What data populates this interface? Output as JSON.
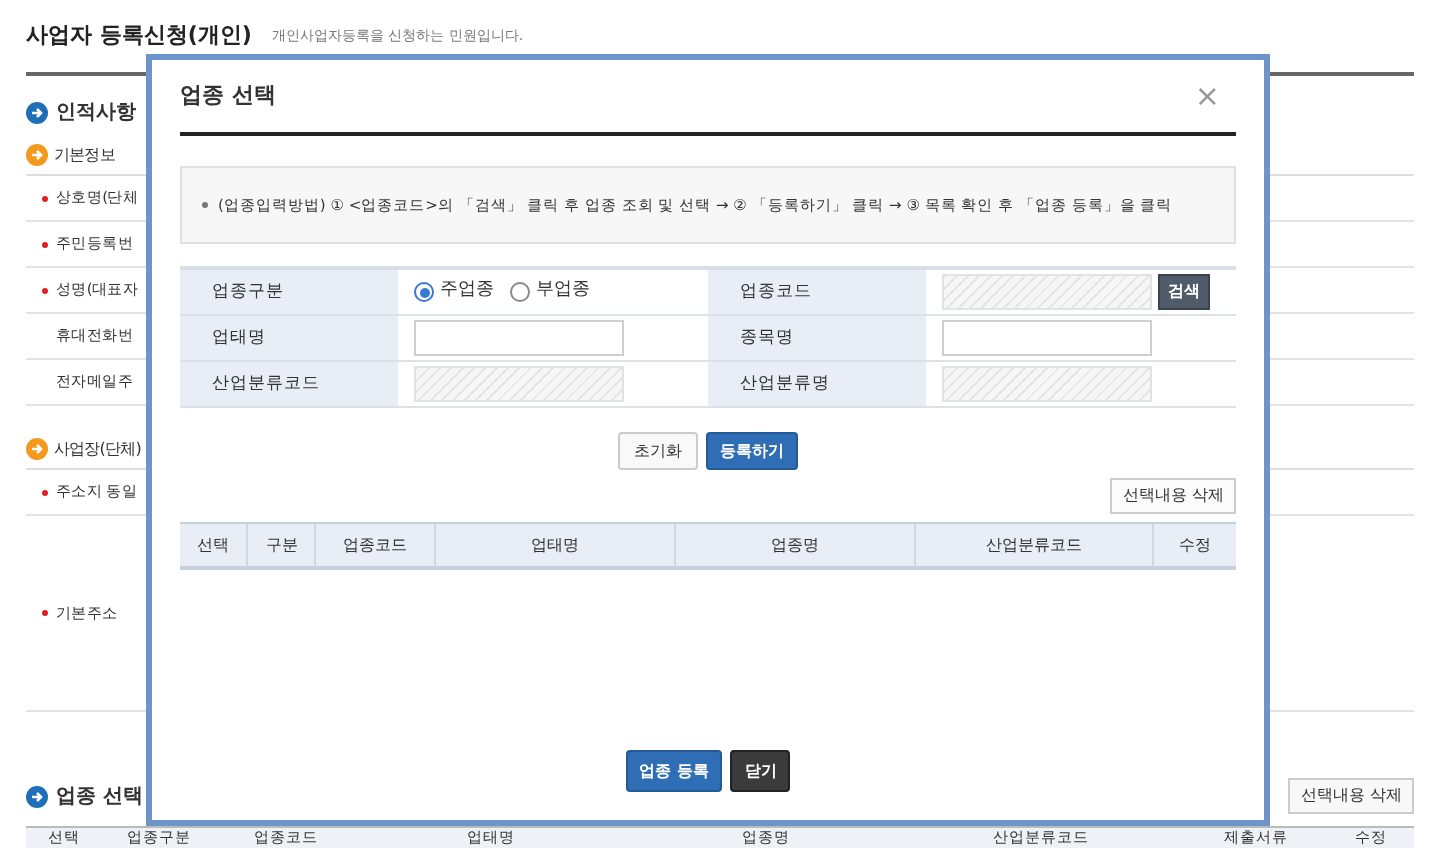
{
  "page": {
    "title": "사업자 등록신청(개인)",
    "subtitle": "개인사업자등록을 신청하는 민원입니다.",
    "sections": [
      {
        "heading": "인적사항",
        "groups": [
          {
            "heading": "기본정보",
            "rows": [
              {
                "label": "상호명(단체",
                "required": true,
                "kind": "single"
              },
              {
                "label": "주민등록번",
                "required": true,
                "kind": "single"
              },
              {
                "label": "성명(대표자",
                "required": true,
                "kind": "single"
              },
              {
                "label": "휴대전화번",
                "required": false,
                "kind": "single"
              },
              {
                "label": "전자메일주",
                "required": false,
                "kind": "single"
              }
            ]
          },
          {
            "heading": "사업장(단체)",
            "rows": [
              {
                "label": "주소지 동일",
                "required": true,
                "kind": "single"
              },
              {
                "label": "기본주소",
                "required": true,
                "kind": "tall"
              }
            ]
          }
        ]
      }
    ],
    "business_section": {
      "heading": "업종 선택",
      "delete_button": "선택내용 삭제",
      "columns": [
        "선택",
        "업종구분",
        "업종코드",
        "업태명",
        "업종명",
        "산업분류코드",
        "제출서류",
        "수정"
      ]
    }
  },
  "modal": {
    "title": "업종 선택",
    "close": "×",
    "notice": "(업종입력방법) ① <업종코드>의 「검색」 클릭 후 업종 조회 및 선택 → ② 「등록하기」 클릭 → ③ 목록 확인 후 「업종 등록」을 클릭",
    "form": [
      {
        "label": "업종구분",
        "kind": "radio",
        "options": [
          {
            "label": "주업종",
            "selected": true
          },
          {
            "label": "부업종",
            "selected": false
          }
        ]
      },
      {
        "label": "업종코드",
        "kind": "field",
        "disabled": true,
        "button": "검색"
      },
      {
        "label": "업태명",
        "kind": "field",
        "disabled": false
      },
      {
        "label": "종목명",
        "kind": "field",
        "disabled": false
      },
      {
        "label": "산업분류코드",
        "kind": "field",
        "disabled": true
      },
      {
        "label": "산업분류명",
        "kind": "field",
        "disabled": true
      }
    ],
    "reset_button": "초기화",
    "add_button": "등록하기",
    "delete_button": "선택내용 삭제",
    "columns": [
      "선택",
      "구분",
      "업종코드",
      "업태명",
      "업종명",
      "산업분류코드",
      "수정"
    ],
    "register_button": "업종 등록",
    "close_button": "닫기"
  }
}
